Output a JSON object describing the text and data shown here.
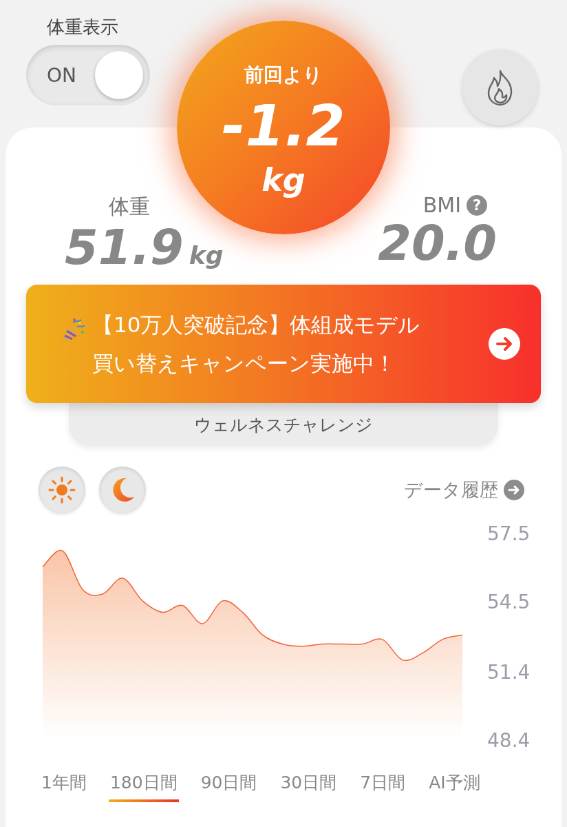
{
  "display_toggle": {
    "label": "体重表示",
    "on": true,
    "text": "ON"
  },
  "change": {
    "label": "前回より",
    "value": "-1.2",
    "unit": "kg"
  },
  "weight": {
    "label": "体重",
    "value": "51.9",
    "unit": "kg"
  },
  "bmi": {
    "label": "BMI",
    "help": "?",
    "value": "20.0"
  },
  "banner": {
    "lines": [
      "【10万人突破記念】体組成モデル",
      "買い替えキャンペーン実施中！"
    ]
  },
  "challenge": "ウェルネスチャレンジ",
  "history_link": "データ履歴",
  "chart_data": {
    "type": "area",
    "ylim": [
      48.4,
      57.5
    ],
    "yticks": [
      57.5,
      54.5,
      51.4,
      48.4
    ],
    "series": [
      {
        "color": "#f0643c",
        "values": [
          56.0,
          56.7,
          55.0,
          54.8,
          55.5,
          54.5,
          54.0,
          54.3,
          53.5,
          54.5,
          54.0,
          53.0,
          52.6,
          52.5,
          52.6,
          52.6,
          52.6,
          52.8,
          51.9,
          52.2,
          52.8,
          53.0
        ]
      }
    ]
  },
  "periods": [
    {
      "label": "1年間",
      "selected": false
    },
    {
      "label": "180日間",
      "selected": true
    },
    {
      "label": "90日間",
      "selected": false
    },
    {
      "label": "30日間",
      "selected": false
    },
    {
      "label": "7日間",
      "selected": false
    },
    {
      "label": "AI予測",
      "selected": false
    }
  ]
}
